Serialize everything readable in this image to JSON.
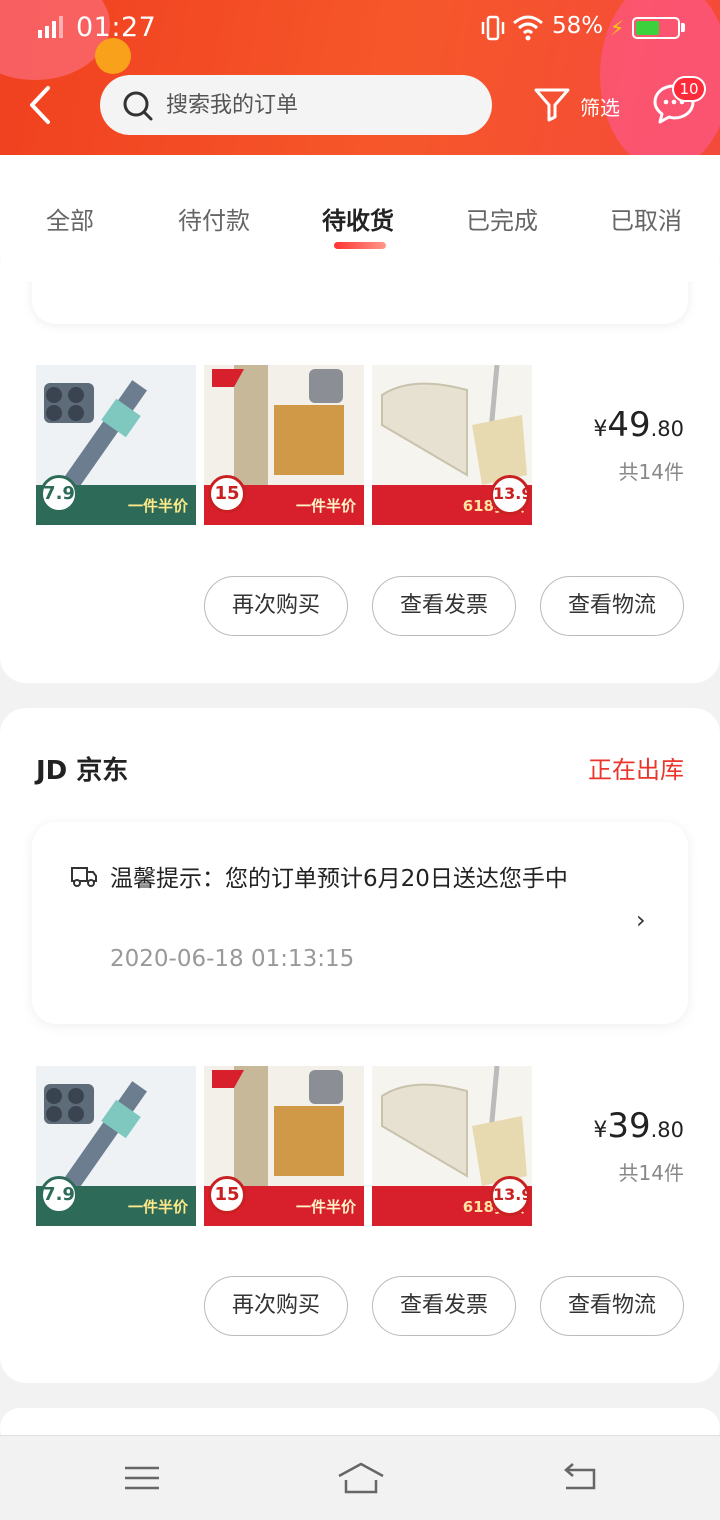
{
  "status_bar": {
    "time": "01:27",
    "battery_percent": "58%",
    "battery_level": 0.58,
    "signal_icon": "signal-bars-icon",
    "wifi_icon": "wifi-icon",
    "vibrate_icon": "vibrate-icon"
  },
  "header": {
    "back_icon": "chevron-left-icon",
    "search_placeholder": "搜索我的订单",
    "filter_label": "筛选",
    "message_badge": "10"
  },
  "tabs": [
    {
      "label": "全部",
      "active": false
    },
    {
      "label": "待付款",
      "active": false
    },
    {
      "label": "待收货",
      "active": true
    },
    {
      "label": "已完成",
      "active": false
    },
    {
      "label": "已取消",
      "active": false
    }
  ],
  "orders": [
    {
      "thumbnails": [
        {
          "label": "一件半价",
          "badge": "7.9"
        },
        {
          "label": "一件半价",
          "badge": "15"
        },
        {
          "label": "618狂欢",
          "badge": "13.9"
        }
      ],
      "price_symbol": "¥",
      "price_int": "49",
      "price_dec": ".80",
      "count": "共14件",
      "buttons": [
        "再次购买",
        "查看发票",
        "查看物流"
      ]
    },
    {
      "shop": "JD 京东",
      "status": "正在出库",
      "tip_text": "温馨提示：您的订单预计6月20日送达您手中",
      "tip_time": "2020-06-18 01:13:15",
      "thumbnails": [
        {
          "label": "一件半价",
          "badge": "7.9"
        },
        {
          "label": "一件半价",
          "badge": "15"
        },
        {
          "label": "618狂欢",
          "badge": "13.9"
        }
      ],
      "price_symbol": "¥",
      "price_int": "39",
      "price_dec": ".80",
      "count": "共14件",
      "buttons": [
        "再次购买",
        "查看发票",
        "查看物流"
      ]
    }
  ],
  "nav": {
    "menu_icon": "menu-icon",
    "home_icon": "home-icon",
    "back_icon": "return-icon"
  },
  "colors": {
    "header": "#f4502a",
    "accent": "#e8362b",
    "tab_underline": "#f33"
  }
}
